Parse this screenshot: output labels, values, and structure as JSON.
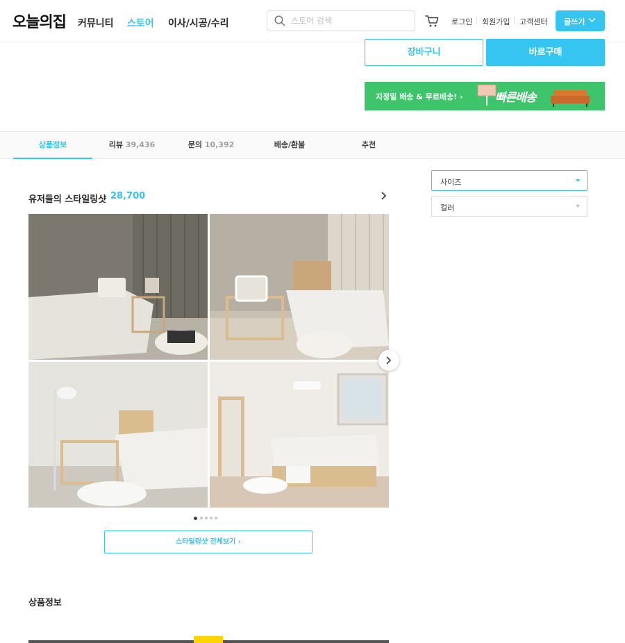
{
  "header": {
    "logo": "오늘의집",
    "nav": [
      "커뮤니티",
      "스토어",
      "이사/시공/수리"
    ],
    "search_placeholder": "스토어 검색",
    "util": [
      "로그인",
      "회원가입",
      "고객센터"
    ],
    "write_label": "글쓰기"
  },
  "purchase": {
    "cart_label": "장바구니",
    "buy_label": "바로구매"
  },
  "banner": {
    "text": "지정일 배송 & 무료배송! ›",
    "fast_text": "빠른배송"
  },
  "tabs": [
    {
      "label": "상품정보",
      "count": ""
    },
    {
      "label": "리뷰",
      "count": "39,436"
    },
    {
      "label": "문의",
      "count": "10,392"
    },
    {
      "label": "배송/환불",
      "count": ""
    },
    {
      "label": "추천",
      "count": ""
    }
  ],
  "options": {
    "size_label": "사이즈",
    "color_label": "컬러"
  },
  "styling": {
    "title": "유저들의 스타일링샷",
    "count": "28,700",
    "view_all": "스타일링샷 전체보기 ›",
    "active_dot": 1,
    "dot_count": 5
  },
  "product_info_title": "상품정보",
  "colors": {
    "accent": "#35c5f0",
    "banner": "#3ec46a"
  }
}
